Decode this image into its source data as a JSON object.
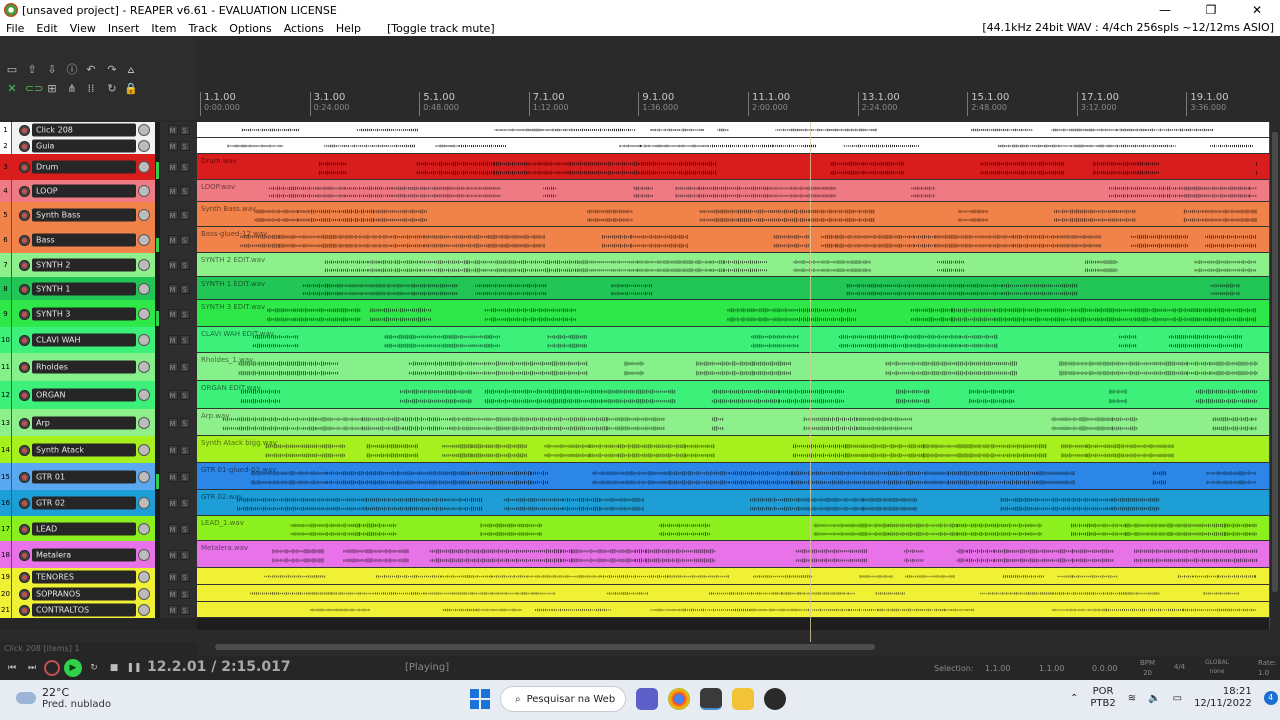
{
  "window": {
    "title": "[unsaved project] - REAPER v6.61 - EVALUATION LICENSE",
    "minimize": "—",
    "maximize": "❐",
    "close": "✕"
  },
  "menu": {
    "items": [
      "File",
      "Edit",
      "View",
      "Insert",
      "Item",
      "Track",
      "Options",
      "Actions",
      "Help"
    ],
    "action_hint": "[Toggle track mute]",
    "audio_status": "[44.1kHz 24bit WAV : 4/4ch 256spls ~12/12ms ASIO]"
  },
  "ruler": {
    "markers": [
      {
        "bar": "1.1.00",
        "time": "0:00.000"
      },
      {
        "bar": "3.1.00",
        "time": "0:24.000"
      },
      {
        "bar": "5.1.00",
        "time": "0:48.000"
      },
      {
        "bar": "7.1.00",
        "time": "1:12.000"
      },
      {
        "bar": "9.1.00",
        "time": "1:36.000"
      },
      {
        "bar": "11.1.00",
        "time": "2:00.000"
      },
      {
        "bar": "13.1.00",
        "time": "2:24.000"
      },
      {
        "bar": "15.1.00",
        "time": "2:48.000"
      },
      {
        "bar": "17.1.00",
        "time": "3:12.000"
      },
      {
        "bar": "19.1.00",
        "time": "3:36.000"
      }
    ]
  },
  "tracks": [
    {
      "num": "1",
      "name": "Click 208",
      "item": "",
      "color": "#ffffff",
      "tcp": "#f2f2f2",
      "numbg": "#ffffff",
      "level": 0.0
    },
    {
      "num": "2",
      "name": "Guia",
      "item": "",
      "color": "#ffffff",
      "tcp": "#f2f2f2",
      "numbg": "#ffffff",
      "level": 0.0
    },
    {
      "num": "3",
      "name": "Drum",
      "item": "Drum.wav",
      "color": "#d91c1c",
      "tcp": "#d91c1c",
      "numbg": "#d91c1c",
      "level": 0.7
    },
    {
      "num": "4",
      "name": "LOOP",
      "item": "LOOP.wav",
      "color": "#f07a84",
      "tcp": "#f07a84",
      "numbg": "#f07a84",
      "level": 0.0
    },
    {
      "num": "5",
      "name": "Synth Bass",
      "item": "Synth Bass.wav",
      "color": "#f0824a",
      "tcp": "#f0824a",
      "numbg": "#f0824a",
      "level": 0.0
    },
    {
      "num": "6",
      "name": "Bass",
      "item": "Bass-glued-12.wav",
      "color": "#f0824a",
      "tcp": "#f0824a",
      "numbg": "#f0824a",
      "level": 0.6
    },
    {
      "num": "7",
      "name": "SYNTH 2",
      "item": "SYNTH 2 EDIT.wav",
      "color": "#8ef08a",
      "tcp": "#8ef08a",
      "numbg": "#8ef08a",
      "level": 0.0
    },
    {
      "num": "8",
      "name": "SYNTH 1",
      "item": "SYNTH 1 EDIT.wav",
      "color": "#22c656",
      "tcp": "#22c656",
      "numbg": "#22c656",
      "level": 0.0
    },
    {
      "num": "9",
      "name": "SYNTH 3",
      "item": "SYNTH 3 EDIT.wav",
      "color": "#2ee84a",
      "tcp": "#2ee84a",
      "numbg": "#2ee84a",
      "level": 0.6
    },
    {
      "num": "10",
      "name": "CLAVI WAH",
      "item": "CLAVI WAH EDIT.wav",
      "color": "#3cf07a",
      "tcp": "#3cf07a",
      "numbg": "#3cf07a",
      "level": 0.0
    },
    {
      "num": "11",
      "name": "Rholdes",
      "item": "Rholdes_1.wav",
      "color": "#86f08a",
      "tcp": "#86f08a",
      "numbg": "#86f08a",
      "level": 0.0
    },
    {
      "num": "12",
      "name": "ORGAN",
      "item": "ORGAN EDIT.wav",
      "color": "#3cf07a",
      "tcp": "#3cf07a",
      "numbg": "#3cf07a",
      "level": 0.0
    },
    {
      "num": "13",
      "name": "Arp",
      "item": "Arp.wav",
      "color": "#8ef08a",
      "tcp": "#8ef08a",
      "numbg": "#8ef08a",
      "level": 0.0
    },
    {
      "num": "14",
      "name": "Synth Atack",
      "item": "Synth Atack bigg.wav",
      "color": "#a6f01e",
      "tcp": "#a6f01e",
      "numbg": "#a6f01e",
      "level": 0.0
    },
    {
      "num": "15",
      "name": "GTR 01",
      "item": "GTR 01-glued-02.wav",
      "color": "#2c86e8",
      "tcp": "#5aa8f0",
      "numbg": "#5aa8f0",
      "level": 0.6
    },
    {
      "num": "16",
      "name": "GTR 02",
      "item": "GTR 02.wav",
      "color": "#1e9ed6",
      "tcp": "#1e9ed6",
      "numbg": "#1e9ed6",
      "level": 0.0
    },
    {
      "num": "17",
      "name": "LEAD",
      "item": "LEAD_1.wav",
      "color": "#8cf01e",
      "tcp": "#8cf01e",
      "numbg": "#8cf01e",
      "level": 0.0
    },
    {
      "num": "18",
      "name": "Metalera",
      "item": "Metalera.wav",
      "color": "#e872e8",
      "tcp": "#e872e8",
      "numbg": "#e872e8",
      "level": 0.0
    },
    {
      "num": "19",
      "name": "TENORES",
      "item": "",
      "color": "#f0f034",
      "tcp": "#f0f034",
      "numbg": "#f0f034",
      "level": 0.0
    },
    {
      "num": "20",
      "name": "SOPRANOS",
      "item": "",
      "color": "#f0f034",
      "tcp": "#f0f034",
      "numbg": "#f0f034",
      "level": 0.0
    },
    {
      "num": "21",
      "name": "CONTRALTOS",
      "item": "",
      "color": "#f0f034",
      "tcp": "#f0f034",
      "numbg": "#f0f034",
      "level": 0.0
    }
  ],
  "mute_label": "M",
  "solo_label": "S",
  "items_status": "Click 208 [items] 1",
  "transport": {
    "position": "12.2.01 / 2:15.017",
    "state": "[Playing]",
    "selection_label": "Selection:",
    "selection_start": "1.1.00",
    "selection_end": "1.1.00",
    "selection_length": "0.0.00",
    "bpm_label": "BPM",
    "bpm_value": "20",
    "time_sig": "4/4",
    "global_label": "GLOBAL",
    "global_value": "none",
    "rate_label": "Rate:",
    "rate_value": "1.0"
  },
  "taskbar": {
    "temperature": "22°C",
    "weather": "Pred. nublado",
    "search": "Pesquisar na Web",
    "lang1": "POR",
    "lang2": "PTB2",
    "time": "18:21",
    "date": "12/11/2022",
    "notifications": "4"
  },
  "icons": [
    "app-icon",
    "search-icon",
    "windows-icon",
    "wifi-icon",
    "volume-icon",
    "battery-icon",
    "record-icon",
    "play-icon",
    "stop-icon",
    "pause-icon",
    "loop-icon"
  ]
}
